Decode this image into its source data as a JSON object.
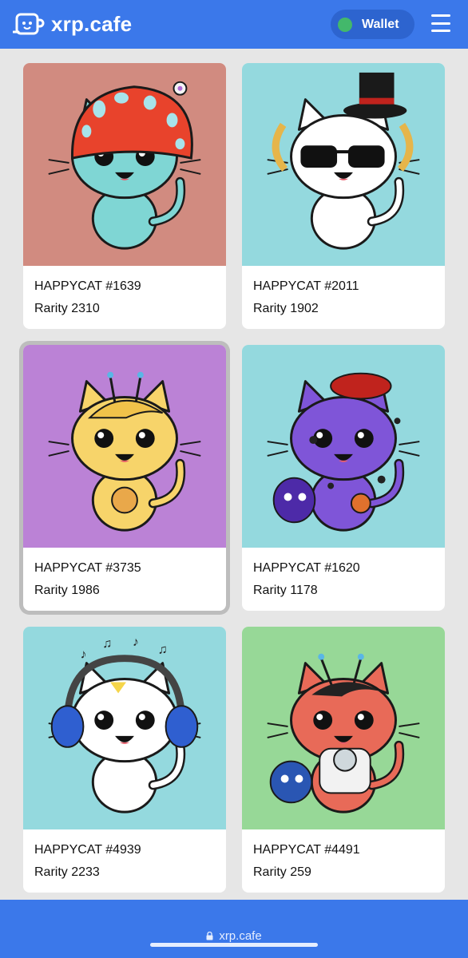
{
  "header": {
    "brand": "xrp.cafe",
    "wallet_label": "Wallet",
    "colors": {
      "bar": "#3b78ea",
      "wallet_pill": "#2d64cf",
      "wallet_status": "#43b86b"
    }
  },
  "items": [
    {
      "name": "HAPPYCAT #1639",
      "rarity": "Rarity 2310",
      "bg": "#d18b80",
      "cat": "#7fd6d4",
      "accessory": "mushroom-hat",
      "selected": false
    },
    {
      "name": "HAPPYCAT #2011",
      "rarity": "Rarity 1902",
      "bg": "#94d9de",
      "cat": "#ffffff",
      "accessory": "top-hat-sunglasses",
      "selected": false
    },
    {
      "name": "HAPPYCAT #3735",
      "rarity": "Rarity 1986",
      "bg": "#bb82d6",
      "cat": "#f7d46a",
      "accessory": "antennae-coin",
      "selected": true
    },
    {
      "name": "HAPPYCAT #1620",
      "rarity": "Rarity 1178",
      "bg": "#94d9de",
      "cat": "#7f55d8",
      "accessory": "beret-dragon",
      "selected": false
    },
    {
      "name": "HAPPYCAT #4939",
      "rarity": "Rarity 2233",
      "bg": "#94d9de",
      "cat": "#ffffff",
      "accessory": "headphones",
      "selected": false
    },
    {
      "name": "HAPPYCAT #4491",
      "rarity": "Rarity 259",
      "bg": "#97d897",
      "cat": "#e86a58",
      "accessory": "astronaut-dragon",
      "selected": false
    }
  ],
  "footer": {
    "url": "xrp.cafe"
  }
}
